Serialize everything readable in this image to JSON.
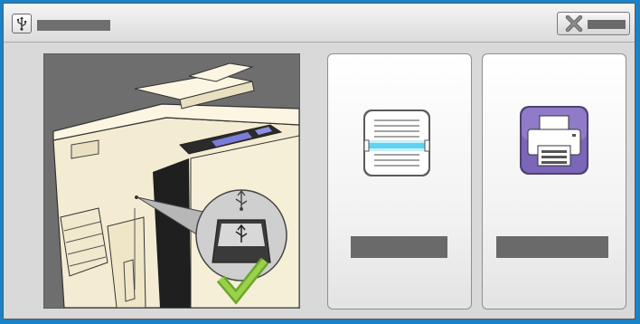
{
  "window": {
    "title": "",
    "title_icon": "usb-icon",
    "close_button_label": "",
    "close_icon": "close-x-icon"
  },
  "options": [
    {
      "label": "",
      "icon": "scan-to-usb-icon"
    },
    {
      "label": "",
      "icon": "print-from-usb-icon"
    }
  ],
  "illustration": {
    "subject": "printer-usb-port-illustration",
    "status_icon": "checkmark-icon"
  },
  "colors": {
    "background_blue": "#1a82c8",
    "window_grey": "#d9d9d9",
    "scan_accent": "#41c3ea",
    "print_purple": "#6f5aa8",
    "check_green": "#8cc63f"
  }
}
